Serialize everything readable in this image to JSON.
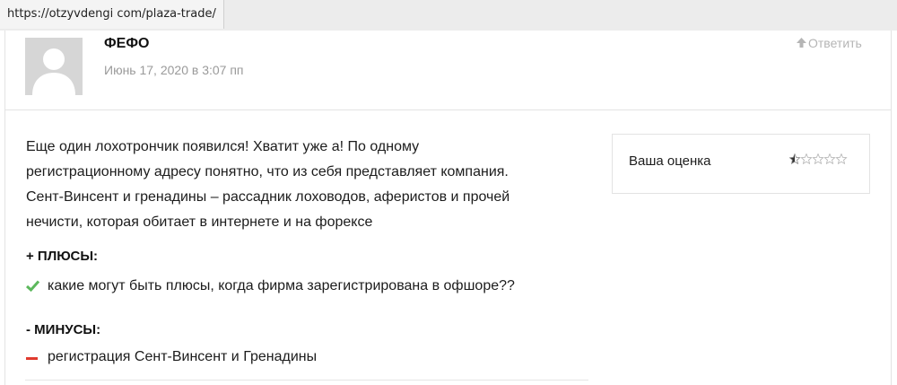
{
  "browser": {
    "url": "https://otzyvdengi com/plaza-trade/"
  },
  "comment": {
    "author": "ФЕФО",
    "date": "Июнь 17, 2020 в 3:07 пп",
    "reply_label": "Ответить",
    "body_lines": [
      "Еще один лохотрончик появился! Хватит уже а! По одному",
      "регистрационному адресу понятно, что из себя представляет компания.",
      "Сент-Винсент и гренадины – рассадник лоховодов, аферистов и прочей",
      "нечисти, которая обитает в интернете и на форексе"
    ],
    "pros_heading": "+ ПЛЮСЫ:",
    "pros": [
      "какие могут быть плюсы, когда фирма зарегистрирована в офшоре??"
    ],
    "cons_heading": "- МИНУСЫ:",
    "cons": [
      "регистрация Сент-Винсент и Гренадины"
    ]
  },
  "rating": {
    "label": "Ваша оценка",
    "value": 0.5,
    "max": 5
  },
  "colors": {
    "check": "#5cb85c",
    "minus": "#e03a2e",
    "muted": "#9a9a9a"
  },
  "icons": {
    "avatar": "user-silhouette-icon",
    "reply": "arrow-up-icon",
    "pro": "checkmark-icon",
    "con": "minus-icon",
    "rating": "star-icon"
  }
}
